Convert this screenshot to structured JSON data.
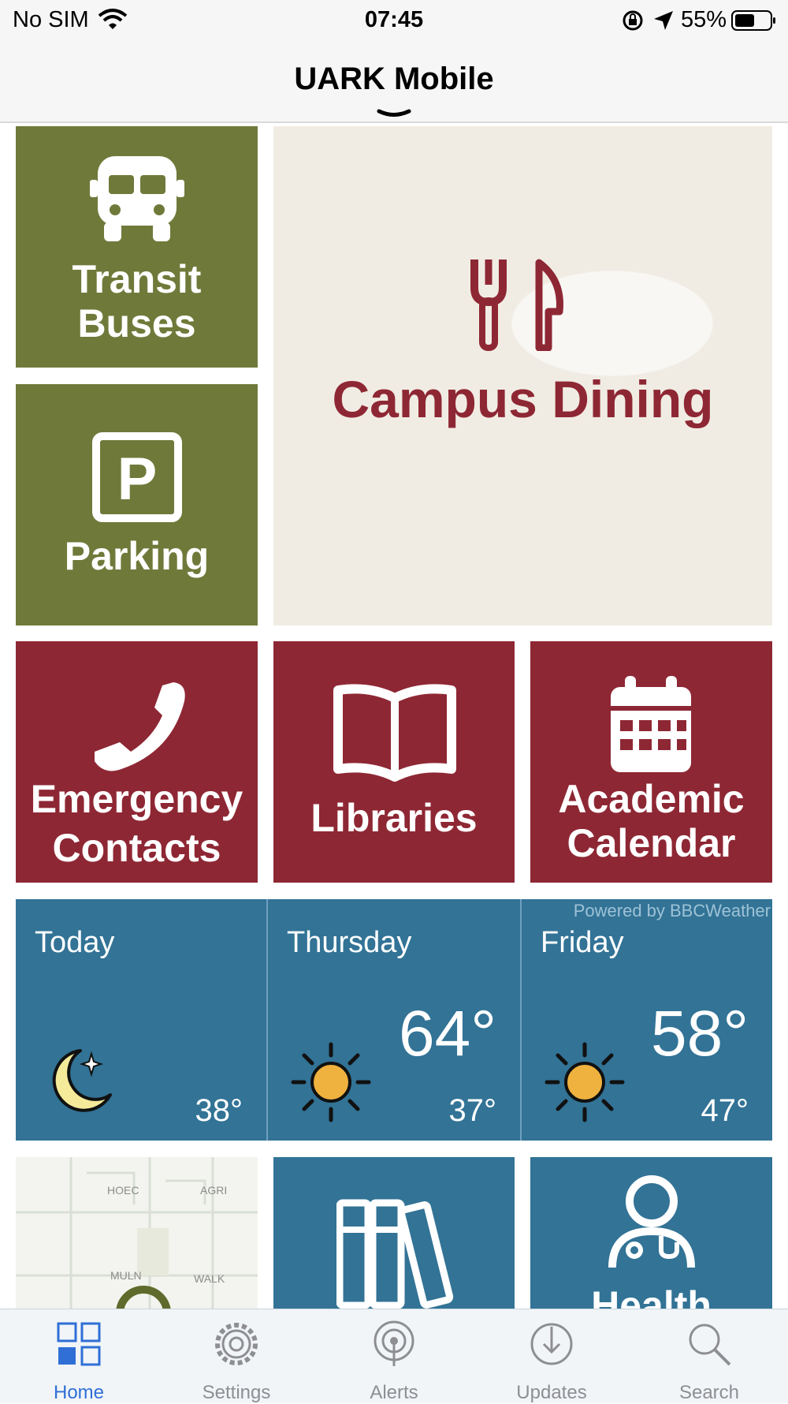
{
  "status_bar": {
    "carrier": "No SIM",
    "time": "07:45",
    "battery": "55%"
  },
  "nav": {
    "title": "UARK Mobile"
  },
  "tiles": {
    "transit": "Transit Buses",
    "parking": "Parking",
    "dining": "Campus Dining",
    "emergency_line1": "Emergency",
    "emergency_line2": "Contacts",
    "libraries": "Libraries",
    "calendar_line1": "Academic",
    "calendar_line2": "Calendar",
    "health_partial": "Health"
  },
  "weather": {
    "attribution": "Powered by BBCWeather",
    "days": [
      {
        "label": "Today",
        "high": "",
        "low": "38°",
        "icon": "moon-icon"
      },
      {
        "label": "Thursday",
        "high": "64°",
        "low": "37°",
        "icon": "sun-icon"
      },
      {
        "label": "Friday",
        "high": "58°",
        "low": "47°",
        "icon": "sun-icon"
      }
    ]
  },
  "map": {
    "labels": [
      "HOEC",
      "AGRI",
      "MULN",
      "WALK"
    ]
  },
  "tabbar": [
    {
      "label": "Home",
      "icon": "grid-icon",
      "active": true
    },
    {
      "label": "Settings",
      "icon": "gear-icon",
      "active": false
    },
    {
      "label": "Alerts",
      "icon": "broadcast-icon",
      "active": false
    },
    {
      "label": "Updates",
      "icon": "download-icon",
      "active": false
    },
    {
      "label": "Search",
      "icon": "magnifier-icon",
      "active": false
    }
  ],
  "colors": {
    "olive": "#6f7a3a",
    "maroon": "#8e2734",
    "blue": "#327396",
    "tab_active": "#2f6fd6"
  }
}
